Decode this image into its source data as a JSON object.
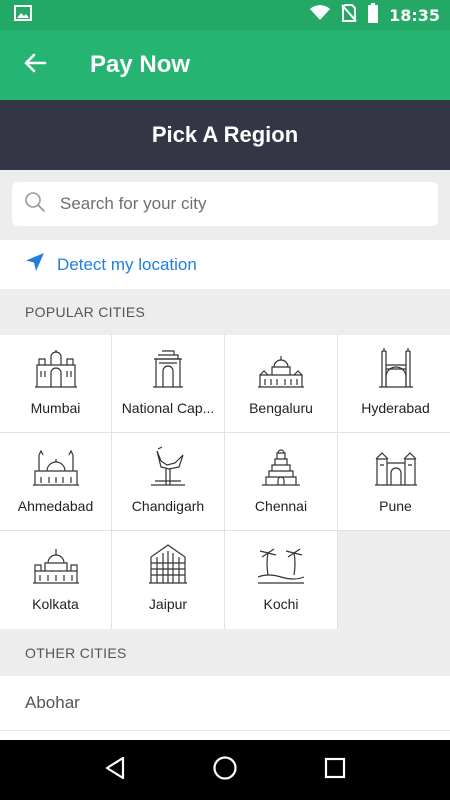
{
  "status_bar": {
    "time": "18:35",
    "icons": [
      "image-icon",
      "wifi-icon",
      "no-sim-icon",
      "battery-icon"
    ]
  },
  "app_bar": {
    "title": "Pay Now",
    "back_icon": "arrow-left-icon",
    "color": "#25b472"
  },
  "region_header": {
    "title": "Pick A Region",
    "color": "#343545"
  },
  "search": {
    "placeholder": "Search for your city",
    "value": ""
  },
  "detect_location": {
    "label": "Detect my location",
    "color": "#1f7fe0"
  },
  "popular": {
    "header": "POPULAR CITIES",
    "cities": [
      {
        "name": "Mumbai",
        "icon": "gateway-of-india-icon"
      },
      {
        "name": "National Cap...",
        "icon": "india-gate-icon"
      },
      {
        "name": "Bengaluru",
        "icon": "vidhana-soudha-icon"
      },
      {
        "name": "Hyderabad",
        "icon": "charminar-icon"
      },
      {
        "name": "Ahmedabad",
        "icon": "mosque-icon"
      },
      {
        "name": "Chandigarh",
        "icon": "open-hand-monument-icon"
      },
      {
        "name": "Chennai",
        "icon": "temple-gopuram-icon"
      },
      {
        "name": "Pune",
        "icon": "shaniwar-wada-icon"
      },
      {
        "name": "Kolkata",
        "icon": "victoria-memorial-icon"
      },
      {
        "name": "Jaipur",
        "icon": "hawa-mahal-icon"
      },
      {
        "name": "Kochi",
        "icon": "palm-beach-icon"
      }
    ]
  },
  "other": {
    "header": "OTHER CITIES",
    "cities": [
      "Abohar"
    ]
  },
  "nav_bar": {
    "icons": [
      "back-triangle-icon",
      "home-circle-icon",
      "recents-square-icon"
    ]
  }
}
